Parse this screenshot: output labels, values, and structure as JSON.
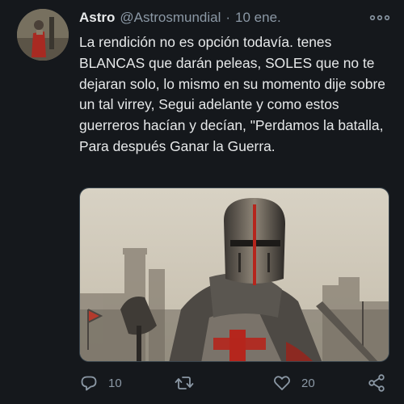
{
  "tweet": {
    "author_name": "Astro",
    "author_handle": "@Astrosmundial",
    "separator": "·",
    "timestamp": "10 ene.",
    "text": "La rendición no es opción todavía. tenes BLANCAS que darán peleas, SOLES que no te dejaran solo, lo mismo en su momento dije sobre un tal virrey, Segui adelante y como estos guerreros hacían y decían, \"Perdamos la batalla, Para después Ganar la Guerra.",
    "media": {
      "subject": "crusader-knight-photo"
    }
  },
  "actions": {
    "reply": {
      "icon": "reply-icon",
      "count": "10"
    },
    "retweet": {
      "icon": "retweet-icon",
      "count": ""
    },
    "like": {
      "icon": "heart-icon",
      "count": "20"
    },
    "share": {
      "icon": "share-icon",
      "count": ""
    }
  },
  "colors": {
    "background": "#15181c",
    "text": "#e7e9ea",
    "secondary": "#8b98a5",
    "border": "#38444d"
  }
}
